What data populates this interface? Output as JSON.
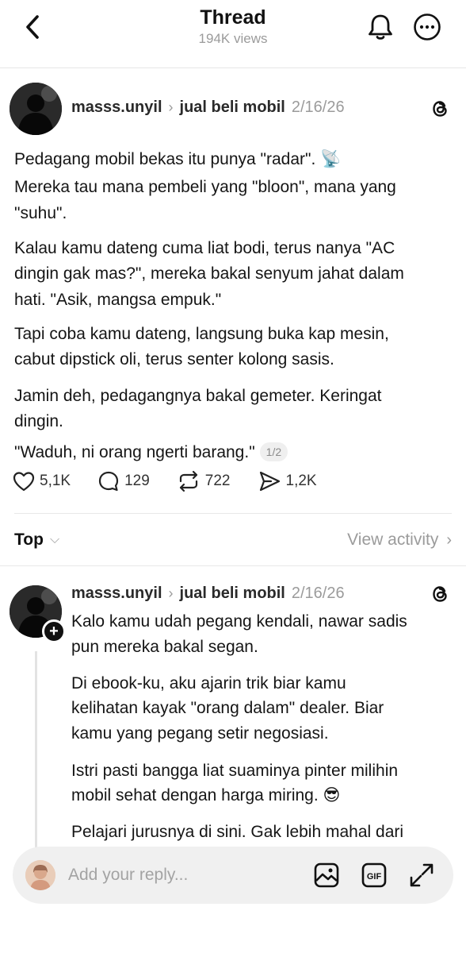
{
  "header": {
    "title": "Thread",
    "views": "194K views"
  },
  "post": {
    "username": "masss.unyil",
    "community": "jual beli mobil",
    "date": "2/16/26",
    "paragraphs": [
      "Pedagang mobil bekas itu punya \"radar\". 📡",
      "Mereka tau mana pembeli yang \"bloon\", mana yang",
      "\"suhu\".",
      "Kalau kamu dateng cuma liat bodi, terus nanya \"AC",
      "dingin gak mas?\", mereka bakal senyum jahat dalam",
      "hati. \"Asik, mangsa empuk.\"",
      "Tapi coba kamu dateng, langsung buka kap mesin,",
      "cabut dipstick oli, terus senter kolong sasis.",
      "Jamin deh, pedagangnya bakal gemeter. Keringat",
      "dingin.",
      "\"Waduh, ni orang ngerti barang.\""
    ],
    "page_badge": "1/2",
    "likes": "5,1K",
    "comments": "129",
    "reposts": "722",
    "shares": "1,2K"
  },
  "sort": {
    "label": "Top",
    "view_activity": "View activity"
  },
  "reply": {
    "username": "masss.unyil",
    "community": "jual beli mobil",
    "date": "2/16/26",
    "lines": [
      "Kalo kamu udah pegang kendali, nawar sadis",
      "pun mereka bakal segan.",
      "Di ebook-ku, aku ajarin trik biar kamu",
      "kelihatan kayak \"orang dalam\" dealer. Biar",
      "kamu yang pegang setir negosiasi.",
      "Istri pasti bangga liat suaminya pinter milihin",
      "mobil sehat dengan harga miring. 😎",
      "Pelajari jurusnya di sini. Gak lebih mahal dari"
    ]
  },
  "reply_bar": {
    "placeholder": "Add your reply..."
  },
  "icons": {
    "back": "chevron-left-icon",
    "bell": "bell-icon",
    "more": "more-horizontal-icon",
    "threads": "threads-logo-icon",
    "like": "heart-icon",
    "comment": "comment-icon",
    "repost": "repost-icon",
    "share": "send-icon",
    "image": "image-icon",
    "gif": "gif-icon",
    "expand": "expand-icon"
  }
}
